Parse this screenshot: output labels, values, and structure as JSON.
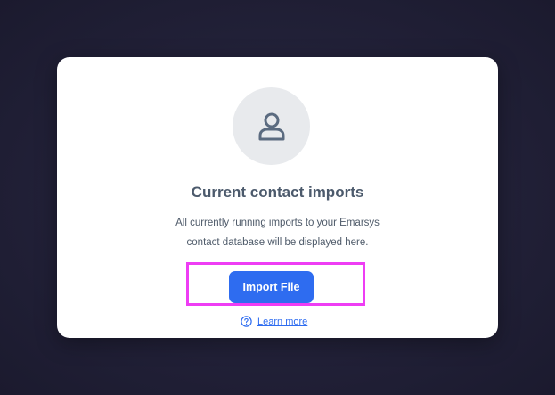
{
  "empty_state": {
    "title": "Current contact imports",
    "description_line1": "All currently running imports to your Emarsys",
    "description_line2": "contact database will be displayed here.",
    "primary_button_label": "Import File",
    "help_link_label": "Learn more",
    "icons": {
      "avatar": "user-icon",
      "help": "question-circle-icon"
    }
  },
  "colors": {
    "button": "#2e6cf0",
    "link": "#2e6cf0",
    "highlight_outline": "#ee3df4",
    "title": "#4c5a6c",
    "avatar_background": "#e8eaed"
  }
}
